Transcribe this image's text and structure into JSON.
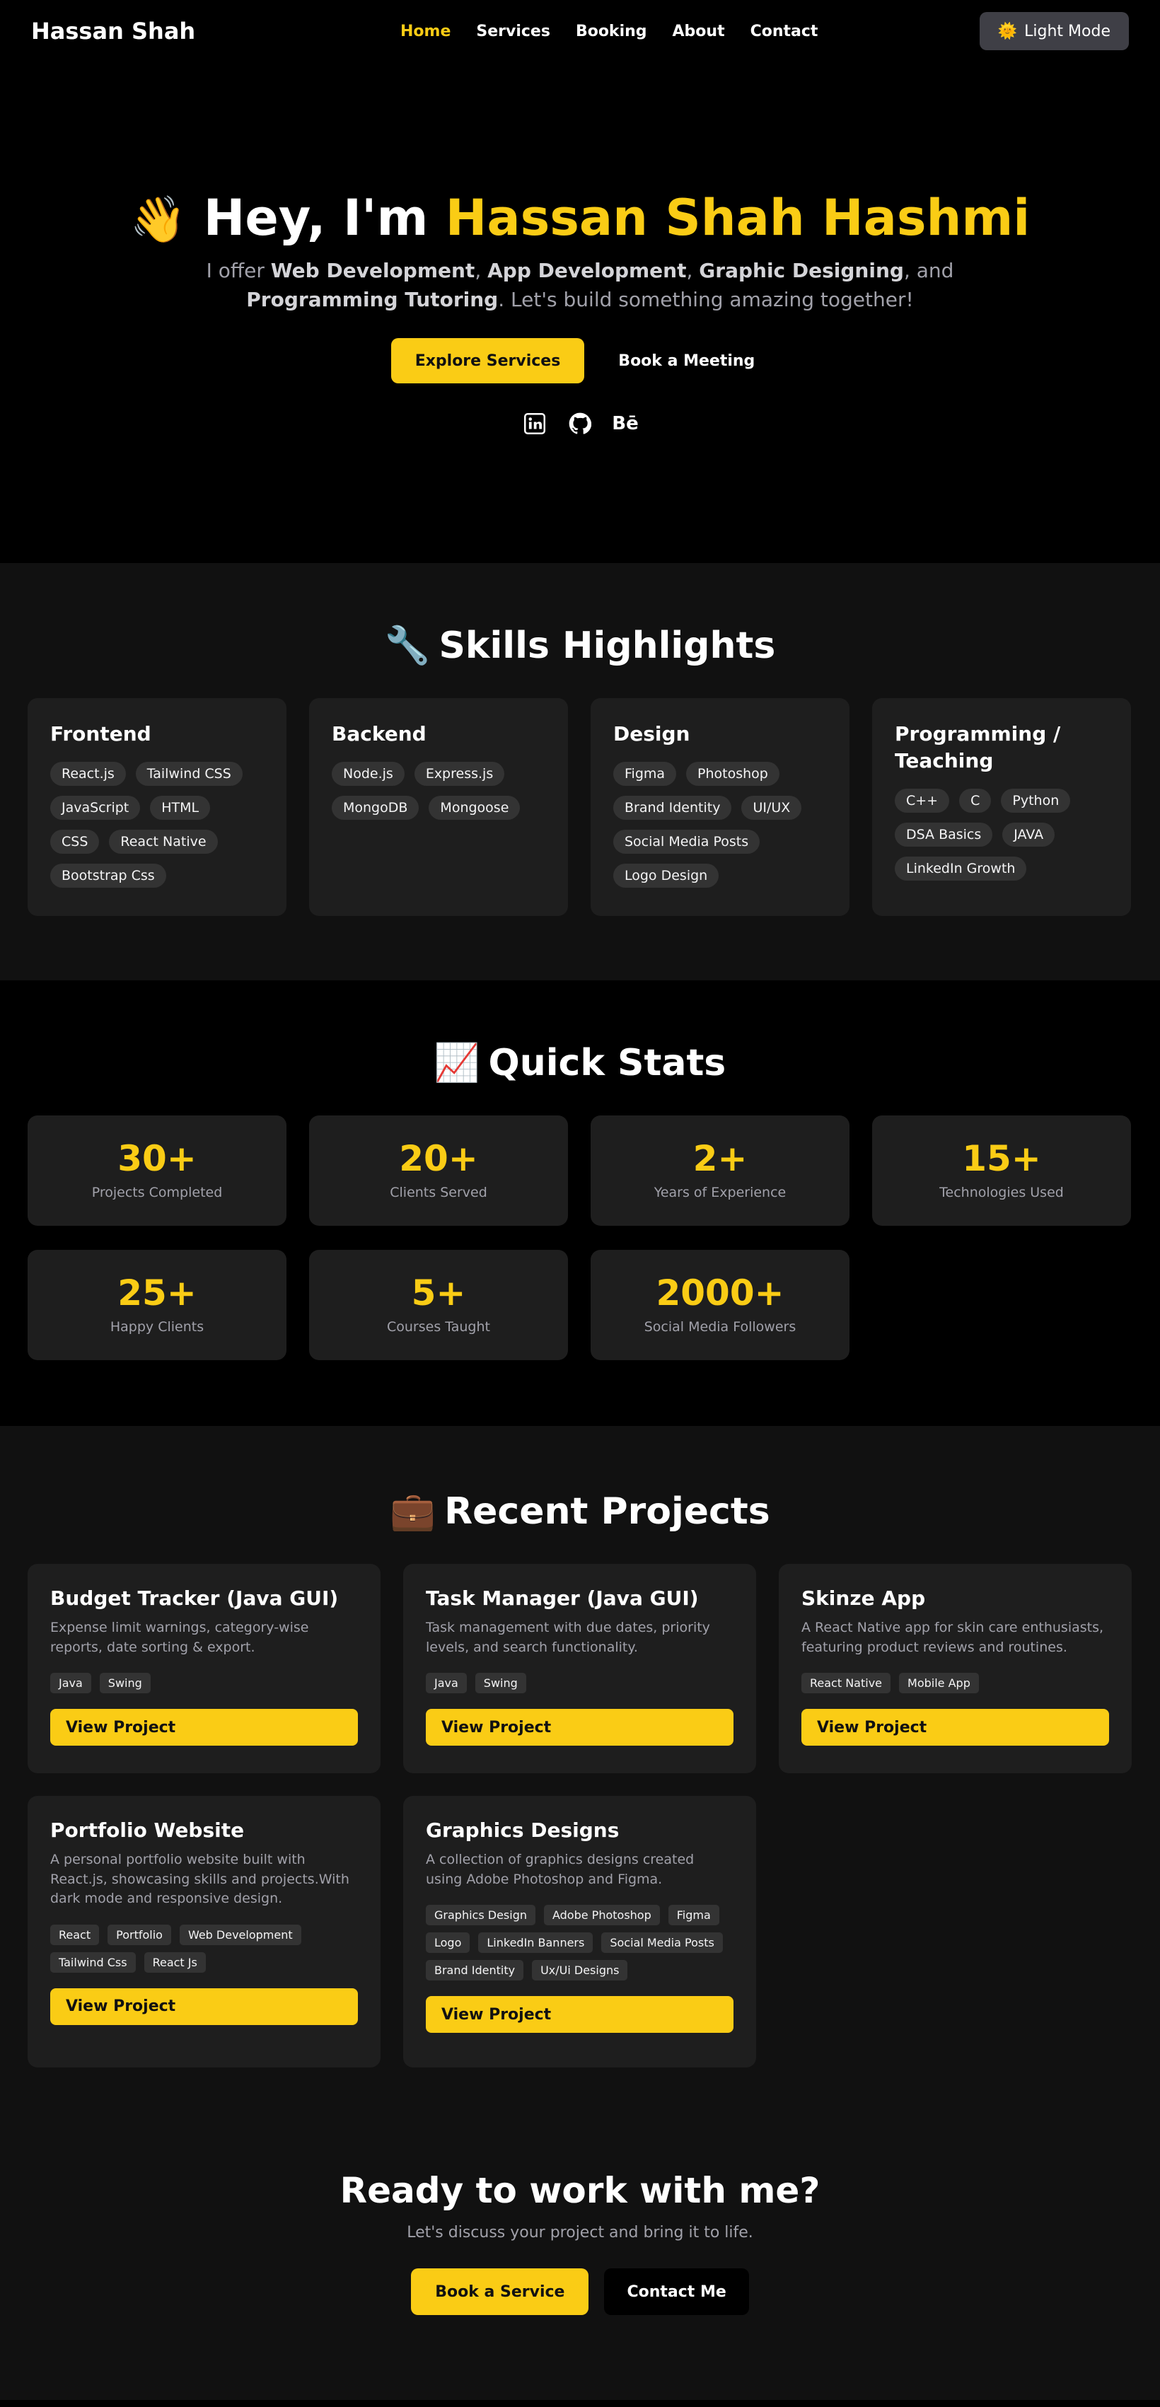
{
  "nav": {
    "brand": "Hassan Shah",
    "links": [
      {
        "label": "Home",
        "active": true
      },
      {
        "label": "Services",
        "active": false
      },
      {
        "label": "Booking",
        "active": false
      },
      {
        "label": "About",
        "active": false
      },
      {
        "label": "Contact",
        "active": false
      }
    ],
    "mode_icon": "🌞",
    "mode_label": "Light Mode"
  },
  "hero": {
    "wave": "👋",
    "greeting": "Hey, I'm",
    "name": "Hassan Shah Hashmi",
    "intro_prefix": "I offer",
    "services": [
      "Web Development",
      "App Development",
      "Graphic Designing",
      "Programming Tutoring"
    ],
    "sep1": ", ",
    "sep2": ", ",
    "sep3": ", and ",
    "outro": ". Let's build something amazing together!",
    "btn_primary": "Explore Services",
    "btn_secondary": "Book a Meeting",
    "socials": [
      "linkedin-icon",
      "github-icon",
      "behance-icon"
    ],
    "behance_text": "Bē"
  },
  "skills": {
    "emoji": "🔧",
    "title": "Skills Highlights",
    "cards": [
      {
        "title": "Frontend",
        "tags": [
          "React.js",
          "Tailwind CSS",
          "JavaScript",
          "HTML",
          "CSS",
          "React Native",
          "Bootstrap Css"
        ]
      },
      {
        "title": "Backend",
        "tags": [
          "Node.js",
          "Express.js",
          "MongoDB",
          "Mongoose"
        ]
      },
      {
        "title": "Design",
        "tags": [
          "Figma",
          "Photoshop",
          "Brand Identity",
          "UI/UX",
          "Social Media Posts",
          "Logo Design"
        ]
      },
      {
        "title": "Programming / Teaching",
        "tags": [
          "C++",
          "C",
          "Python",
          "DSA Basics",
          "JAVA",
          "LinkedIn Growth"
        ]
      }
    ]
  },
  "stats": {
    "emoji": "📈",
    "title": "Quick Stats",
    "items": [
      {
        "num": "30+",
        "label": "Projects Completed"
      },
      {
        "num": "20+",
        "label": "Clients Served"
      },
      {
        "num": "2+",
        "label": "Years of Experience"
      },
      {
        "num": "15+",
        "label": "Technologies Used"
      },
      {
        "num": "25+",
        "label": "Happy Clients"
      },
      {
        "num": "5+",
        "label": "Courses Taught"
      },
      {
        "num": "2000+",
        "label": "Social Media Followers"
      }
    ]
  },
  "projects": {
    "emoji": "💼",
    "title": "Recent Projects",
    "view_label": "View Project",
    "items": [
      {
        "title": "Budget Tracker (Java GUI)",
        "desc": "Expense limit warnings, category-wise reports, date sorting & export.",
        "tags": [
          "Java",
          "Swing"
        ]
      },
      {
        "title": "Task Manager (Java GUI)",
        "desc": "Task management with due dates, priority levels, and search functionality.",
        "tags": [
          "Java",
          "Swing"
        ]
      },
      {
        "title": "Skinze App",
        "desc": "A React Native app for skin care enthusiasts, featuring product reviews and routines.",
        "tags": [
          "React Native",
          "Mobile App"
        ]
      },
      {
        "title": "Portfolio Website",
        "desc": "A personal portfolio website built with React.js, showcasing skills and projects.With dark mode and responsive design.",
        "tags": [
          "React",
          "Portfolio",
          "Web Development",
          "Tailwind Css",
          "React Js"
        ]
      },
      {
        "title": "Graphics Designs",
        "desc": "A collection of graphics designs created using Adobe Photoshop and Figma.",
        "tags": [
          "Graphics Design",
          "Adobe Photoshop",
          "Figma",
          "Logo",
          "LinkedIn Banners",
          "Social Media Posts",
          "Brand Identity",
          "Ux/Ui Designs"
        ]
      }
    ]
  },
  "cta": {
    "title": "Ready to work with me?",
    "subtitle": "Let's discuss your project and bring it to life.",
    "btn_primary": "Book a Service",
    "btn_secondary": "Contact Me"
  }
}
